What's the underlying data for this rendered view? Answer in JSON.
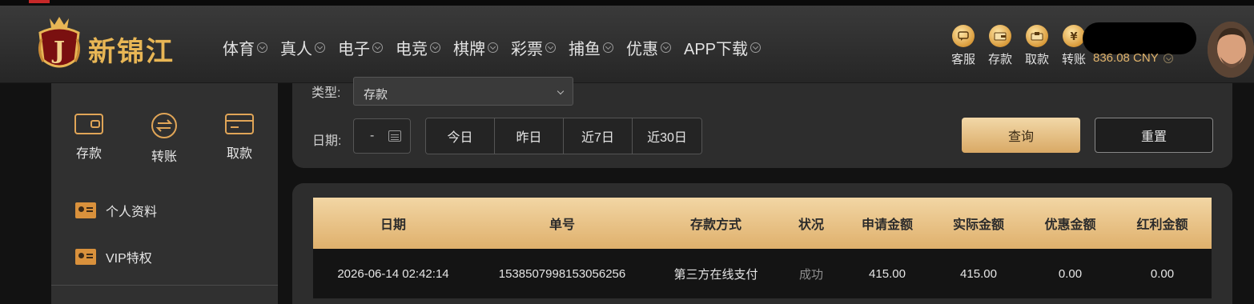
{
  "brand": {
    "name": "新锦江",
    "accent": "#e8b655"
  },
  "nav": [
    {
      "label": "体育"
    },
    {
      "label": "真人"
    },
    {
      "label": "电子"
    },
    {
      "label": "电竞"
    },
    {
      "label": "棋牌"
    },
    {
      "label": "彩票"
    },
    {
      "label": "捕鱼"
    },
    {
      "label": "优惠"
    },
    {
      "label": "APP下载"
    }
  ],
  "tools": [
    {
      "label": "客服",
      "icon": "chat-icon"
    },
    {
      "label": "存款",
      "icon": "wallet-icon"
    },
    {
      "label": "取款",
      "icon": "withdraw-icon"
    },
    {
      "label": "转账",
      "icon": "transfer-icon"
    }
  ],
  "balance": {
    "text": "836.08 CNY"
  },
  "sidebar": {
    "actions": [
      {
        "label": "存款",
        "icon": "wallet-icon"
      },
      {
        "label": "转账",
        "icon": "transfer-icon"
      },
      {
        "label": "取款",
        "icon": "card-icon"
      }
    ],
    "menu": [
      {
        "label": "个人资料"
      },
      {
        "label": "VIP特权"
      }
    ]
  },
  "filter": {
    "type_label": "类型:",
    "type_value": "存款",
    "date_label": "日期:",
    "date_value": "-",
    "quick": [
      {
        "label": "今日"
      },
      {
        "label": "昨日"
      },
      {
        "label": "近7日"
      },
      {
        "label": "近30日"
      }
    ],
    "query_label": "查询",
    "reset_label": "重置"
  },
  "table": {
    "headers": [
      "日期",
      "单号",
      "存款方式",
      "状况",
      "申请金额",
      "实际金额",
      "优惠金额",
      "红利金额"
    ],
    "rows": [
      [
        "2026-06-14 02:42:14",
        "1538507998153056256",
        "第三方在线支付",
        "成功",
        "415.00",
        "415.00",
        "0.00",
        "0.00"
      ]
    ]
  }
}
